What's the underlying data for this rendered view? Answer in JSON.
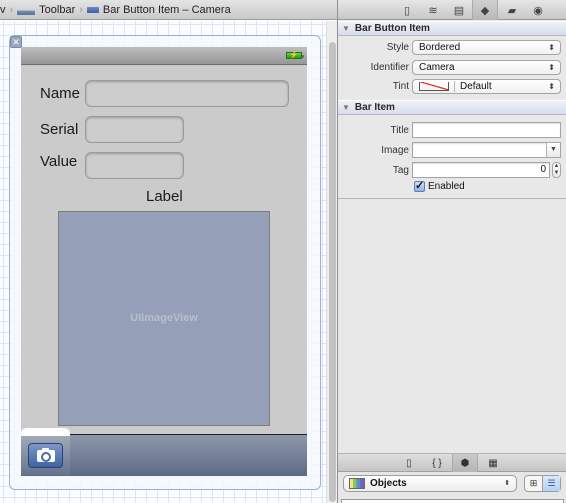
{
  "jumpbar": {
    "crumbs": [
      {
        "label": "v",
        "icon": "view-icon"
      },
      {
        "label": "Toolbar",
        "icon": "toolbar-icon"
      },
      {
        "label": "Bar Button Item – Camera",
        "icon": "bar-button-item-icon"
      }
    ],
    "separator": "›"
  },
  "canvas": {
    "close_glyph": "✕",
    "battery_glyph": "⚡",
    "form": {
      "fields": [
        {
          "label": "Name",
          "value": ""
        },
        {
          "label": "Serial",
          "value": ""
        },
        {
          "label": "Value",
          "value": ""
        }
      ],
      "label_text": "Label",
      "image_view_caption": "UIImageView"
    },
    "toolbar": {
      "items": [
        {
          "name": "camera",
          "icon": "camera-icon"
        }
      ]
    }
  },
  "inspector": {
    "tabs": [
      {
        "name": "file-inspector",
        "glyph": "▯"
      },
      {
        "name": "quick-help",
        "glyph": "≋"
      },
      {
        "name": "identity-inspector",
        "glyph": "▤"
      },
      {
        "name": "attributes-inspector",
        "glyph": "◆",
        "active": true
      },
      {
        "name": "size-inspector",
        "glyph": "▰"
      },
      {
        "name": "connections-inspector",
        "glyph": "◉"
      }
    ],
    "sections": {
      "bar_button_item": {
        "title": "Bar Button Item",
        "style_label": "Style",
        "style_value": "Bordered",
        "identifier_label": "Identifier",
        "identifier_value": "Camera",
        "tint_label": "Tint",
        "tint_value": "Default"
      },
      "bar_item": {
        "title": "Bar Item",
        "title_label": "Title",
        "title_value": "",
        "image_label": "Image",
        "image_value": "",
        "tag_label": "Tag",
        "tag_value": "0",
        "enabled_label": "Enabled",
        "enabled_checked": true
      }
    },
    "popup_arrows": "⬍",
    "combo_arrow": "▼",
    "stepper_up": "▲",
    "stepper_down": "▼",
    "check_glyph": "✓",
    "disclosure_glyph": "▼"
  },
  "library": {
    "tabs": [
      {
        "name": "file-templates",
        "glyph": "▯"
      },
      {
        "name": "code-snippets",
        "glyph": "{ }"
      },
      {
        "name": "objects",
        "glyph": "⬢",
        "active": true
      },
      {
        "name": "media",
        "glyph": "▦"
      }
    ],
    "popup_value": "Objects",
    "view_modes": [
      {
        "name": "grid",
        "glyph": "⊞"
      },
      {
        "name": "list",
        "glyph": "☰",
        "active": true
      }
    ]
  }
}
